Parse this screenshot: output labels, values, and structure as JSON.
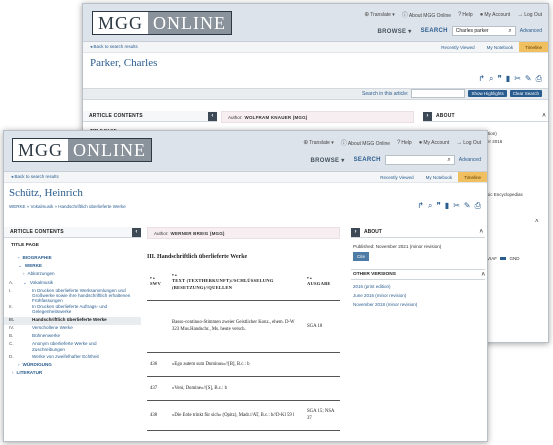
{
  "header": {
    "logo_left": "MGG",
    "logo_right": "ONLINE",
    "translate": "Translate",
    "about": "About MGG Online",
    "help": "Help",
    "my_account": "My Account",
    "log_out": "Log Out",
    "browse": "BROWSE",
    "search_label": "SEARCH",
    "advanced": "Advanced"
  },
  "subbar": {
    "back_to_results": "Back to search results",
    "recently_viewed": "Recently Viewed",
    "my_notebook": "My Notebook",
    "timeline": "Timeline"
  },
  "back_window": {
    "search_value": "Charles parker",
    "title": "Parker, Charles",
    "search_in_article": "Search in this article:",
    "show_highlights": "Show Highlights",
    "clear_search": "Clear Search",
    "article_contents": "ARTICLE CONTENTS",
    "about": "ABOUT",
    "title_page_partial": "TITLE PAGE",
    "author_prefix": "Author:",
    "author_name": "WOLFRAM KNAUER (MGG)",
    "side_fragments": [
      "ition)",
      "er 2016",
      "sic Encyclopedias",
      "VIAF",
      "GND"
    ]
  },
  "front_window": {
    "search_value": "",
    "title": "Schütz, Heinrich",
    "breadcrumb": "WERKE » Vokalmusik » Handschriftlich überlieferte Werke",
    "article_contents": "ARTICLE CONTENTS",
    "toc": {
      "title_page": "TITLE PAGE",
      "items": [
        {
          "num": "",
          "label": "BIOGRAPHIE",
          "style": "caps"
        },
        {
          "num": "",
          "label": "WERKE",
          "style": "caps"
        },
        {
          "num": "",
          "label": "Abkürzungen",
          "style": "sub"
        },
        {
          "num": "A.",
          "label": "Vokalmusik",
          "style": "sub"
        },
        {
          "num": "I.",
          "label": "In Drucken überlieferte Werksammlungen und Großwerke sowie ihre handschriftlich erhaltenen Frühfassungen",
          "style": "two"
        },
        {
          "num": "II.",
          "label": "In Drucken überlieferte Auftrags- und Gelegenheitswerke",
          "style": "two"
        },
        {
          "num": "III.",
          "label": "Handschriftlich überlieferte Werke",
          "style": "hl"
        },
        {
          "num": "IV.",
          "label": "Verschollene Werke",
          "style": "norm"
        },
        {
          "num": "B.",
          "label": "Bühnenwerke",
          "style": "norm"
        },
        {
          "num": "C.",
          "label": "Anonym überlieferte Werke und Zuschreibungen",
          "style": "two"
        },
        {
          "num": "D.",
          "label": "Werke von zweifelhafter Echtheit",
          "style": "norm"
        },
        {
          "num": "",
          "label": "WÜRDIGUNG",
          "style": "caps"
        },
        {
          "num": "",
          "label": "LITERATUR",
          "style": "caps"
        }
      ]
    },
    "author_prefix": "Author:",
    "author_name": "WERNER BREIG (MGG)",
    "section_heading": "III. Handschriftlich überlieferte Werke",
    "table": {
      "headers": [
        "SWV",
        "TEXT (TEXTHERKUNFT)//SCHLÜSSELUNG (BESETZUNG)//QUELLEN",
        "AUSGABE"
      ],
      "rows": [
        {
          "nr": "",
          "text": "Basso-continuo-Stimmen zweier Geistlicher Konz., ehem. D-W 323 Mus.Handschr., Ms. heute versch.",
          "src": "SGA 18"
        },
        {
          "nr": "436",
          "text": "»Ego autem sum Dominus«//[B], B.c.: b",
          "src": ""
        },
        {
          "nr": "437",
          "text": "»Veni, Domine«//[S], B.c.: b",
          "src": ""
        },
        {
          "nr": "438",
          "text": "»Die Erde trinkt für sich« (Opitz), Madr.//AT, B.c.: b//D-Kl 59 l",
          "src": "SGA 15; NSA 37"
        }
      ]
    },
    "about": "ABOUT",
    "published": "Published: November 2021 (minor revision)",
    "cite": "Cite",
    "other_versions": "OTHER VERSIONS",
    "versions": [
      "2016 (print edition)",
      "June 2016 (minor revision)",
      "November 2018 (minor revision)"
    ]
  }
}
